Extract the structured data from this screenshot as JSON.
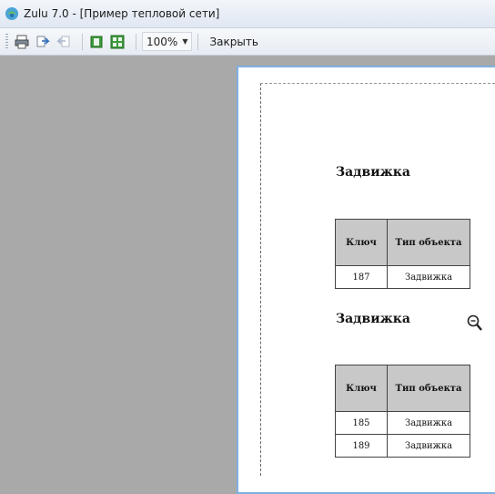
{
  "window": {
    "title": "Zulu 7.0 - [Пример тепловой сети]"
  },
  "toolbar": {
    "icons": [
      "print-icon",
      "page-forward-icon",
      "page-back-icon",
      "single-page-icon",
      "multi-page-icon"
    ],
    "zoom_value": "100%",
    "close_label": "Закрыть"
  },
  "report": {
    "sections": [
      {
        "title": "Задвижка",
        "columns": [
          "Ключ",
          "Тип объекта"
        ],
        "rows": [
          [
            "187",
            "Задвижка"
          ]
        ]
      },
      {
        "title": "Задвижка",
        "columns": [
          "Ключ",
          "Тип объекта"
        ],
        "rows": [
          [
            "185",
            "Задвижка"
          ],
          [
            "189",
            "Задвижка"
          ]
        ]
      }
    ]
  },
  "colors": {
    "workspace": "#a9a9a9",
    "page": "#ffffff",
    "page_border": "#7fb0e0",
    "header_cell": "#c8c8c8"
  }
}
